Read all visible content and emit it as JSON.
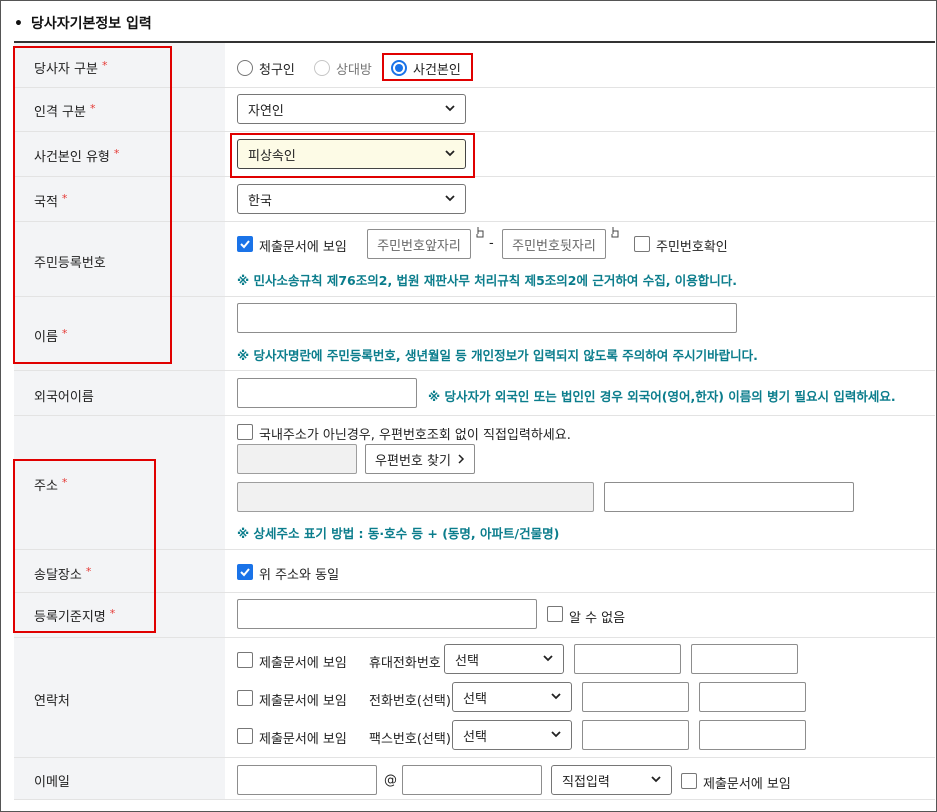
{
  "section": {
    "title": "당사자기본정보 입력"
  },
  "labels": {
    "party_type": "당사자 구분",
    "person_type": "인격 구분",
    "principal_type": "사건본인 유형",
    "nationality": "국적",
    "rrn": "주민등록번호",
    "name": "이름",
    "foreign_name": "외국어이름",
    "address": "주소",
    "delivery": "송달장소",
    "registry": "등록기준지명",
    "contact": "연락처",
    "email": "이메일"
  },
  "required_mark": "*",
  "party_type": {
    "options": [
      {
        "label": "청구인",
        "state": "off"
      },
      {
        "label": "상대방",
        "state": "disabled"
      },
      {
        "label": "사건본인",
        "state": "on"
      }
    ]
  },
  "person_type": {
    "value": "자연인"
  },
  "principal_type": {
    "value": "피상속인"
  },
  "nationality": {
    "value": "한국"
  },
  "rrn": {
    "show_label": "제출문서에 보임",
    "show_checked": true,
    "front_placeholder": "주민번호앞자리",
    "separator": "-",
    "back_placeholder": "주민번호뒷자리",
    "confirm_label": "주민번호확인",
    "note": "※ 민사소송규칙 제76조의2, 법원 재판사무 처리규칙 제5조의2에 근거하여 수집, 이용합니다."
  },
  "name": {
    "value": "",
    "note": "※ 당사자명란에 주민등록번호, 생년월일 등 개인정보가 입력되지 않도록 주의하여 주시기바랍니다."
  },
  "foreign_name": {
    "value": "",
    "note": "※ 당사자가 외국인 또는 법인인 경우 외국어(영어,한자) 이름의 병기 필요시 입력하세요."
  },
  "address": {
    "direct_label": "국내주소가 아닌경우, 우편번호조회 없이 직접입력하세요.",
    "postal_button": "우편번호 찾기",
    "note": "※ 상세주소 표기 방법 : 동·호수 등 + (동명, 아파트/건물명)"
  },
  "delivery": {
    "same_label": "위 주소와 동일",
    "same_checked": true
  },
  "registry": {
    "value": "",
    "unknown_label": "알 수 없음"
  },
  "contact": {
    "rows": [
      {
        "show_label": "제출문서에 보임",
        "type_label": "휴대전화번호",
        "select": "선택"
      },
      {
        "show_label": "제출문서에 보임",
        "type_label": "전화번호(선택)",
        "select": "선택"
      },
      {
        "show_label": "제출문서에 보임",
        "type_label": "팩스번호(선택)",
        "select": "선택"
      }
    ]
  },
  "email": {
    "at": "@",
    "domain_select": "직접입력",
    "show_label": "제출문서에 보임"
  },
  "colors": {
    "accent": "#1a73e8",
    "required": "#e53935",
    "note": "#0b7d8c",
    "highlight": "#e00000"
  }
}
